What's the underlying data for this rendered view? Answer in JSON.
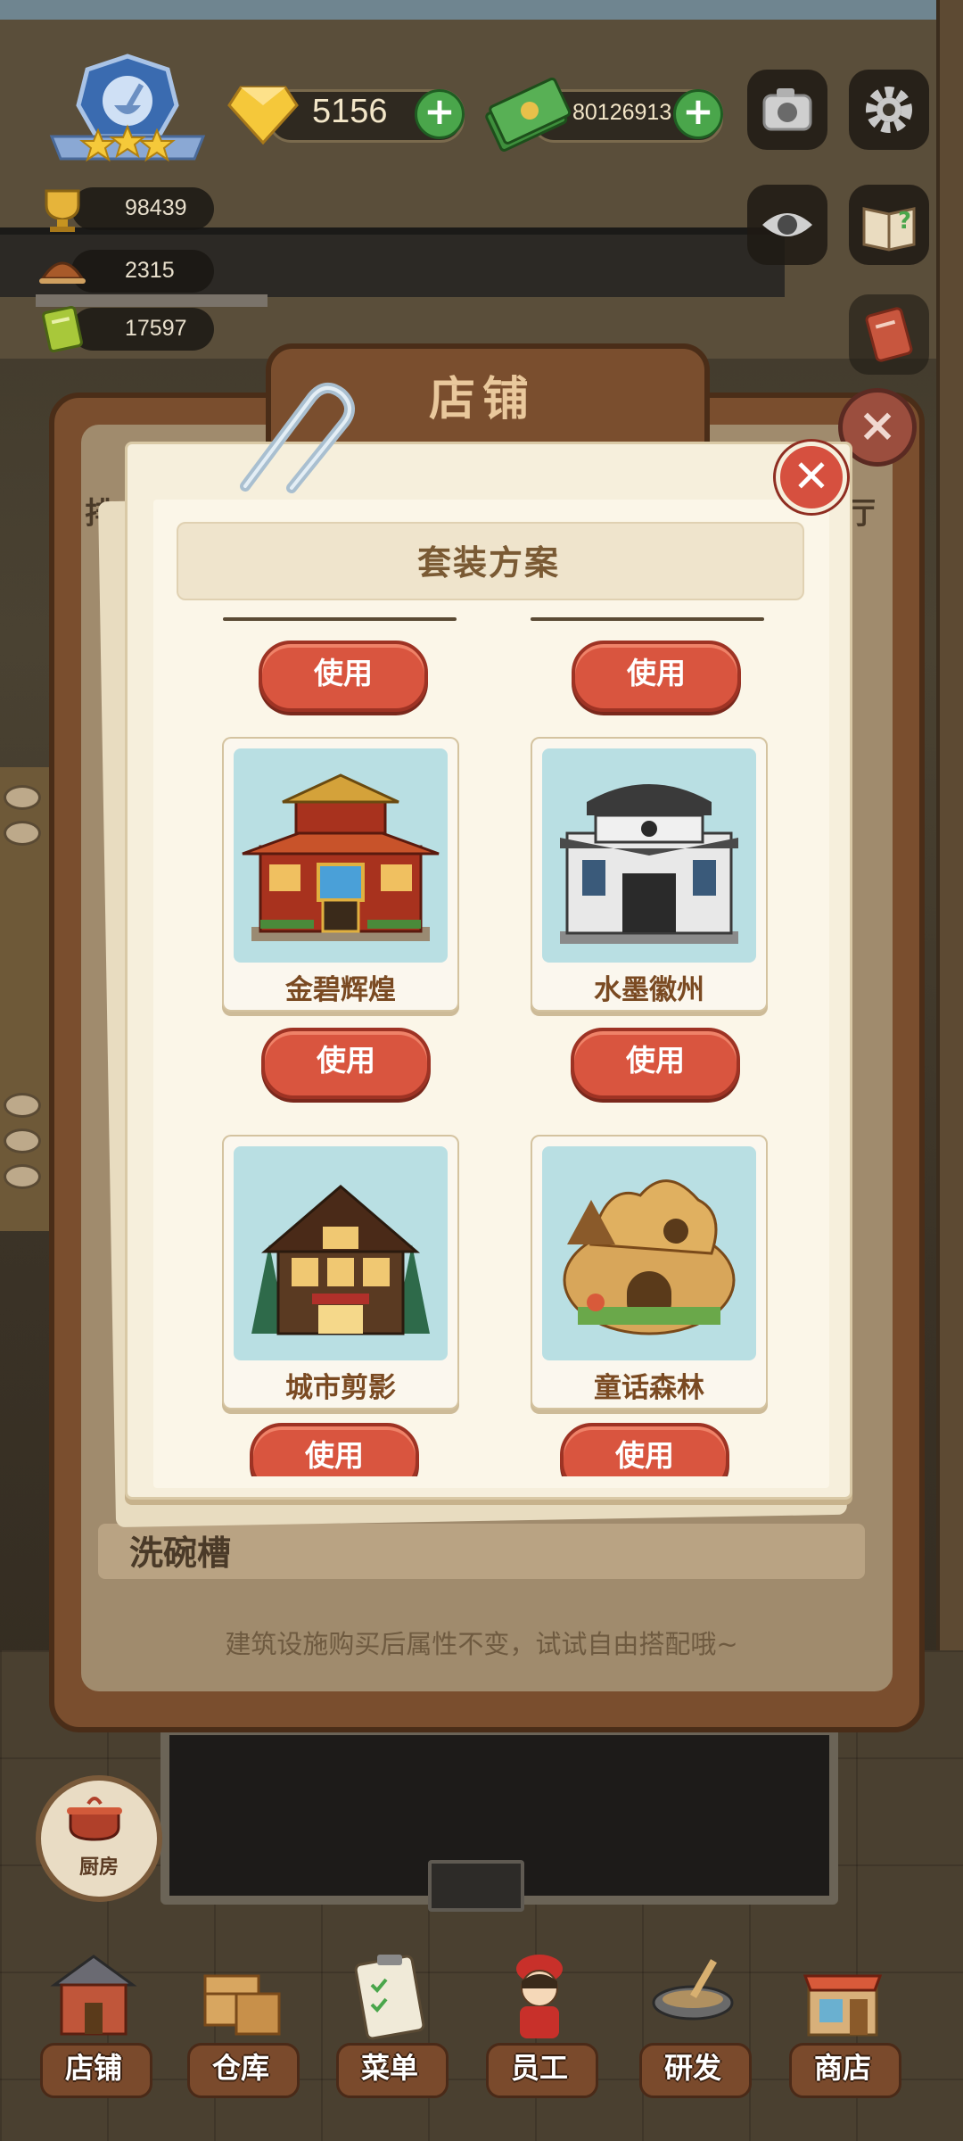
{
  "hud": {
    "gems": "5156",
    "cash": "80126913",
    "stats": [
      "98439",
      "2315",
      "17597"
    ],
    "badge_stars": 3
  },
  "store": {
    "title": "店铺",
    "left_tab_fragment": "排",
    "right_tab_fragment": "厅",
    "row_label": "洗碗槽",
    "hint": "建筑设施购买后属性不变，试试自由搭配哦~"
  },
  "dialog": {
    "title": "套装方案",
    "use_label": "使用",
    "sets": [
      {
        "name": "金碧辉煌",
        "icon": "golden-palace-icon"
      },
      {
        "name": "水墨徽州",
        "icon": "ink-huizhou-house-icon"
      },
      {
        "name": "城市剪影",
        "icon": "city-cabin-icon"
      },
      {
        "name": "童话森林",
        "icon": "fairy-forest-house-icon"
      }
    ]
  },
  "kitchen": {
    "label": "厨房"
  },
  "nav": [
    {
      "label": "店铺",
      "icon": "shop-icon"
    },
    {
      "label": "仓库",
      "icon": "warehouse-icon"
    },
    {
      "label": "菜单",
      "icon": "menu-clipboard-icon"
    },
    {
      "label": "员工",
      "icon": "staff-icon"
    },
    {
      "label": "研发",
      "icon": "research-wok-icon"
    },
    {
      "label": "商店",
      "icon": "store-icon"
    }
  ]
}
